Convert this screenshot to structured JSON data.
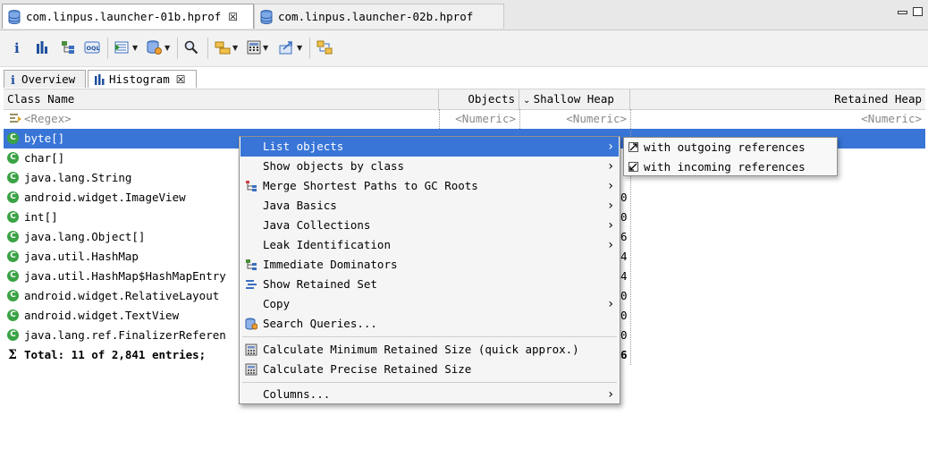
{
  "editor_tabs": [
    {
      "label": "com.linpus.launcher-01b.hprof",
      "active": true
    },
    {
      "label": "com.linpus.launcher-02b.hprof",
      "active": false
    }
  ],
  "inner_tabs": [
    {
      "label": "Overview",
      "icon": "info-icon"
    },
    {
      "label": "Histogram",
      "icon": "histogram-icon"
    }
  ],
  "table": {
    "columns": [
      "Class Name",
      "Objects",
      "Shallow Heap",
      "Retained Heap"
    ],
    "filter_row": {
      "class_name": "<Regex>",
      "objects": "<Numeric>",
      "shallow": "<Numeric>",
      "retained": "<Numeric>"
    },
    "rows": [
      {
        "name": "byte[]",
        "selected": true,
        "objects": "",
        "shallow": "",
        "retained": ""
      },
      {
        "name": "char[]",
        "objects": "",
        "shallow": "",
        "retained": ""
      },
      {
        "name": "java.lang.String",
        "objects": "",
        "shallow": "",
        "retained": ""
      },
      {
        "name": "android.widget.ImageView",
        "objects": "",
        "shallow": "0",
        "retained": ""
      },
      {
        "name": "int[]",
        "objects": "",
        "shallow": "0",
        "retained": ""
      },
      {
        "name": "java.lang.Object[]",
        "objects": "",
        "shallow": "6",
        "retained": ""
      },
      {
        "name": "java.util.HashMap",
        "objects": "",
        "shallow": "4",
        "retained": ""
      },
      {
        "name": "java.util.HashMap$HashMapEntry",
        "objects": "",
        "shallow": "4",
        "retained": ""
      },
      {
        "name": "android.widget.RelativeLayout",
        "objects": "",
        "shallow": "0",
        "retained": ""
      },
      {
        "name": "android.widget.TextView",
        "objects": "",
        "shallow": "0",
        "retained": ""
      },
      {
        "name": "java.lang.ref.FinalizerReferen",
        "objects": "",
        "shallow": "0",
        "retained": ""
      }
    ],
    "total": {
      "label": "Total: 11 of 2,841 entries;",
      "shallow": "6"
    }
  },
  "context_menu": {
    "items": [
      {
        "label": "List objects",
        "submenu": true,
        "highlighted": true
      },
      {
        "label": "Show objects by class",
        "submenu": true
      },
      {
        "label": "Merge Shortest Paths to GC Roots",
        "submenu": true,
        "icon": "merge-paths-icon"
      },
      {
        "label": "Java Basics",
        "submenu": true
      },
      {
        "label": "Java Collections",
        "submenu": true
      },
      {
        "label": "Leak Identification",
        "submenu": true
      },
      {
        "label": "Immediate Dominators",
        "icon": "dominator-tree-icon"
      },
      {
        "label": "Show Retained Set",
        "icon": "retained-set-icon"
      },
      {
        "label": "Copy",
        "submenu": true
      },
      {
        "label": "Search Queries...",
        "icon": "search-queries-icon"
      },
      {
        "label": "Calculate Minimum Retained Size (quick approx.)",
        "icon": "calculator-icon"
      },
      {
        "label": "Calculate Precise Retained Size",
        "icon": "calculator-icon"
      },
      {
        "label": "Columns...",
        "submenu": true
      }
    ],
    "submenu": [
      {
        "label": "with outgoing references"
      },
      {
        "label": "with incoming references"
      }
    ]
  }
}
